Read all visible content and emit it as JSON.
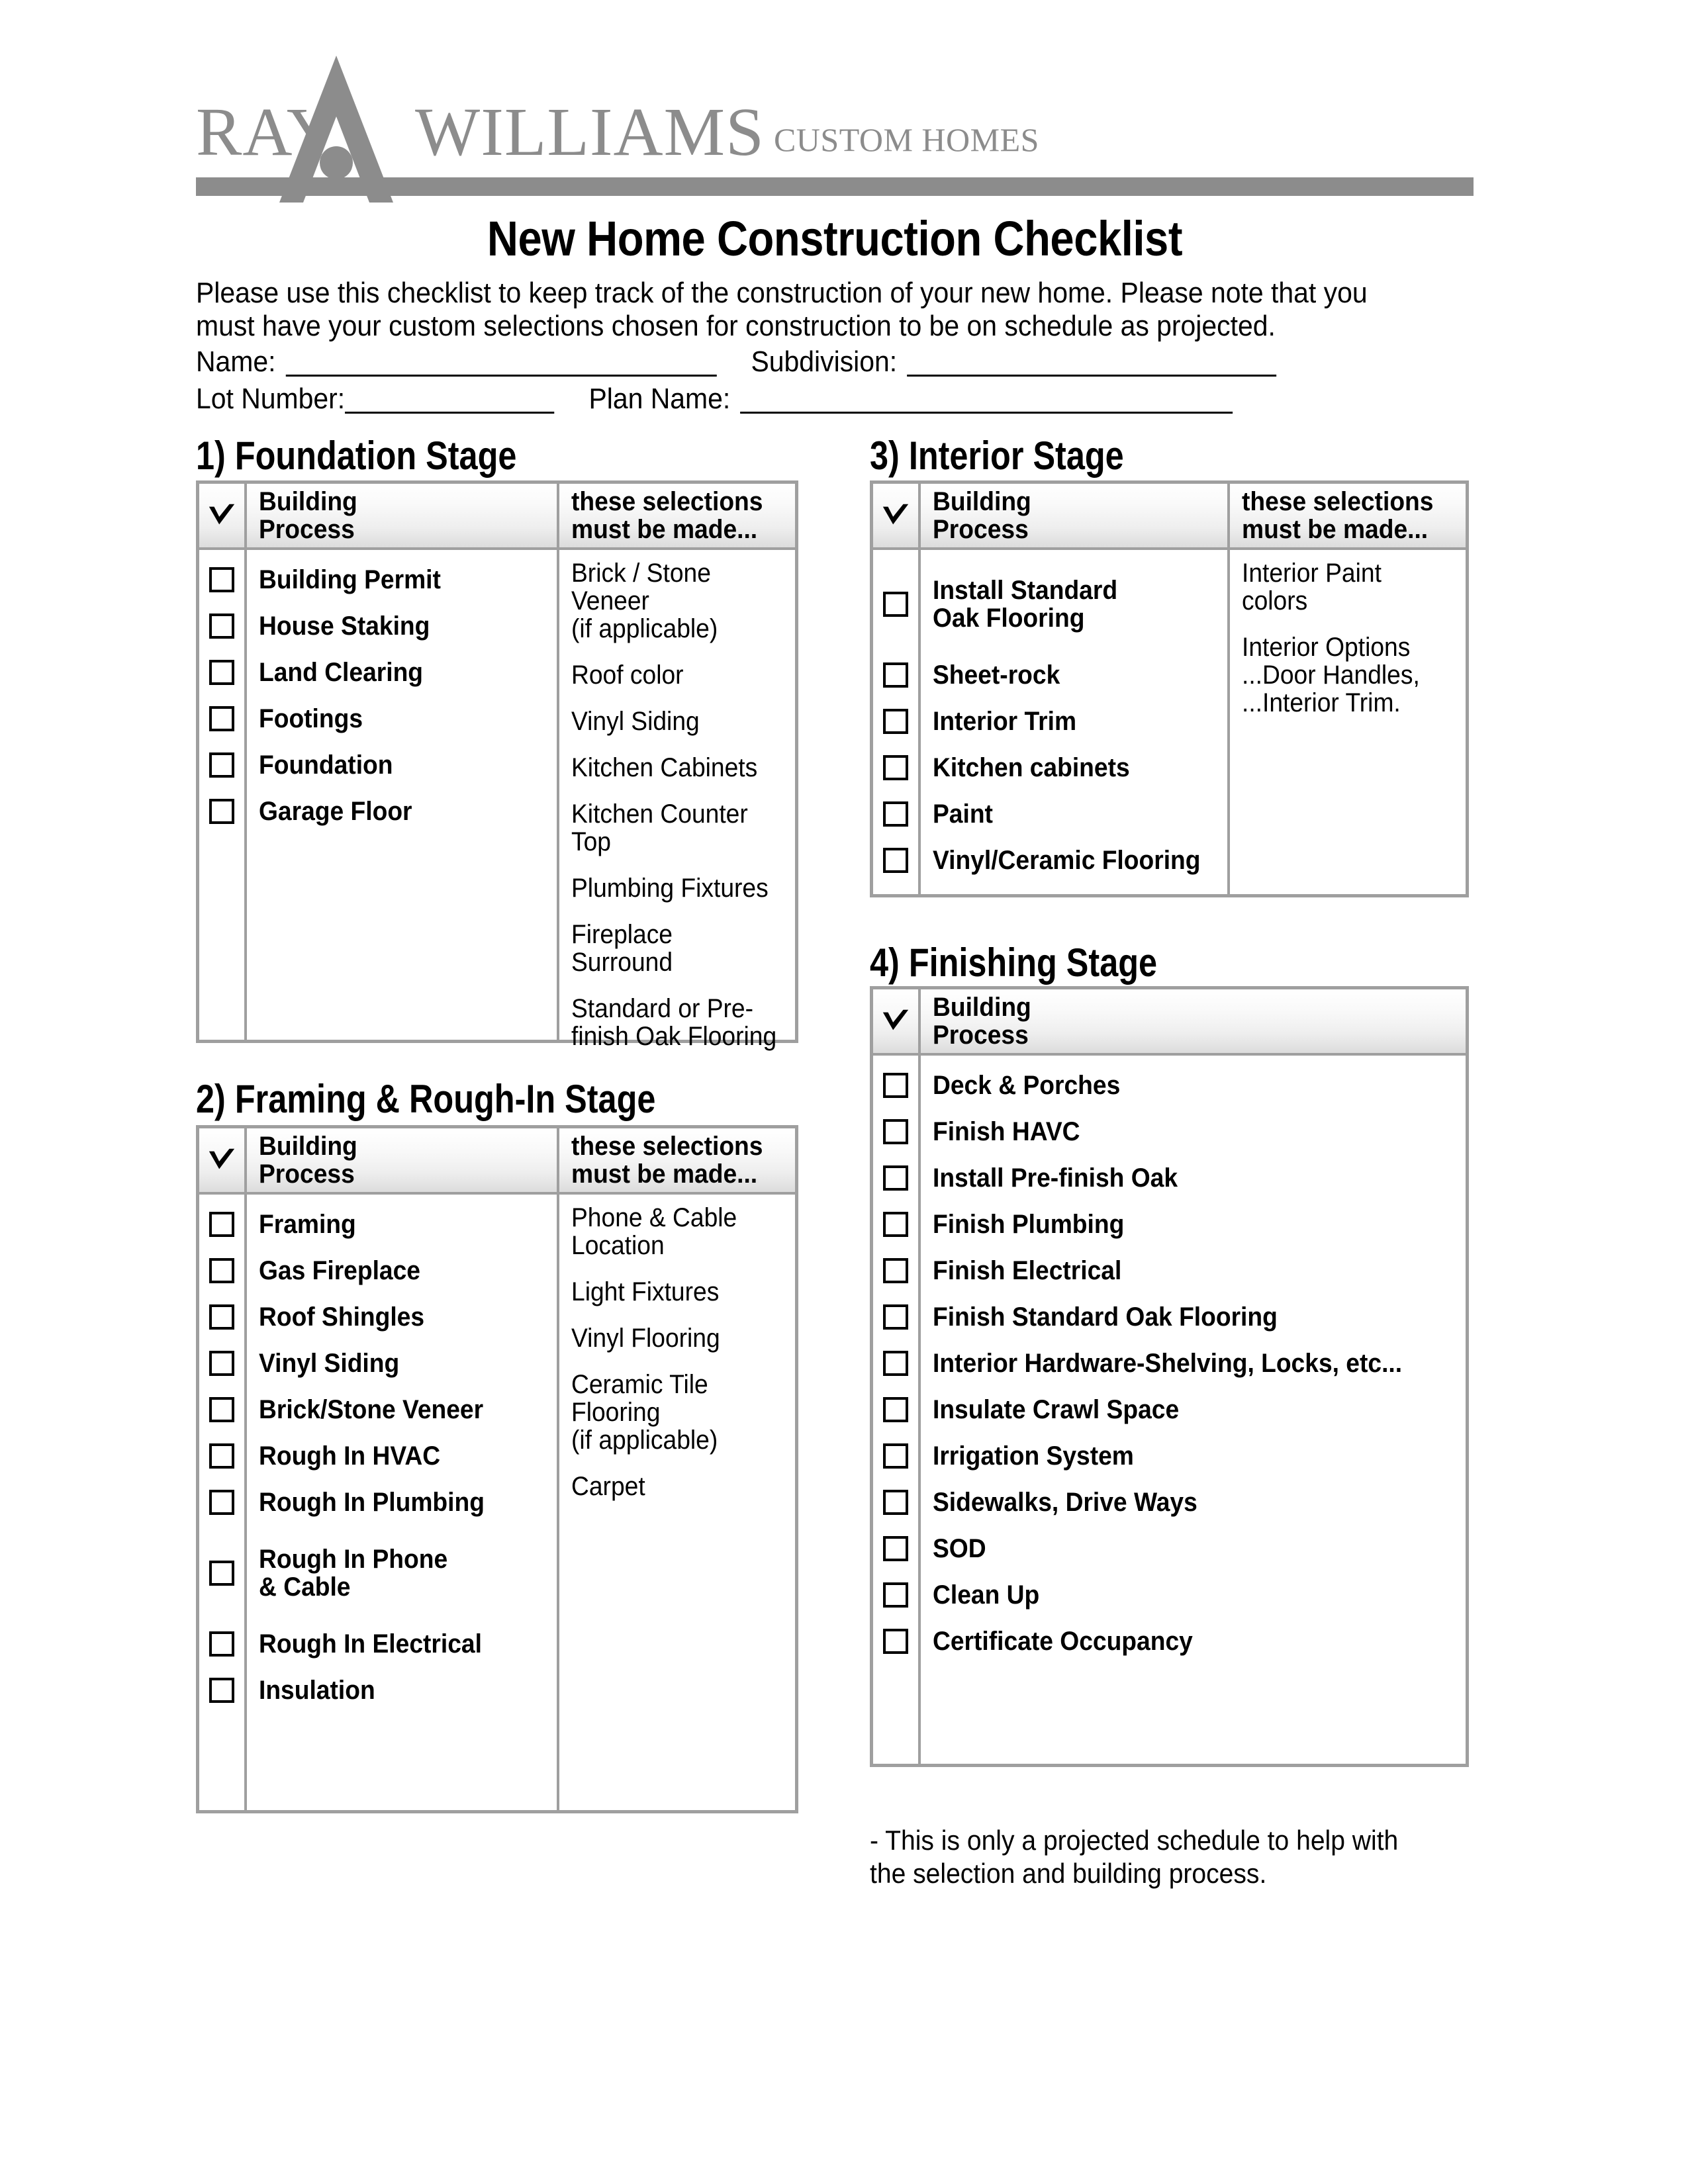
{
  "brand": {
    "name_part1": "RAY",
    "name_part2": "WILLIAMS",
    "tagline": "CUSTOM HOMES",
    "logo_color": "#8c8c8c",
    "mark_icon": "house-peak-icon"
  },
  "document": {
    "title": "New Home Construction Checklist",
    "intro": "Please use this checklist to keep track of the construction of your new home. Please note that you must have your custom selections chosen for construction to be on schedule as projected.",
    "footnote": "- This is only a projected schedule to help with the selection and building process."
  },
  "fields": {
    "name_label": "Name:",
    "subdivision_label": "Subdivision:",
    "lot_label": "Lot Number:",
    "plan_label": "Plan Name:",
    "name_value": "",
    "subdivision_value": "",
    "lot_value": "",
    "plan_value": ""
  },
  "table_headers": {
    "process": "Building\nProcess",
    "process_line1": "Building",
    "process_line2": "Process",
    "selections_line1": "these selections",
    "selections_line2": "must be made...",
    "check_icon": "checkmark-icon"
  },
  "sections": [
    {
      "number": "1)",
      "heading": "1) Foundation Stage",
      "process_items": [
        "Building Permit",
        "House Staking",
        "Land Clearing",
        "Footings",
        "Foundation",
        "Garage Floor"
      ],
      "selection_items": [
        "Brick / Stone Veneer\n(if applicable)",
        "Roof color",
        "Vinyl Siding",
        "Kitchen Cabinets",
        "Kitchen Counter Top",
        "Plumbing Fixtures",
        "Fireplace Surround",
        "Standard or Pre-\nfinish Oak Flooring"
      ]
    },
    {
      "number": "2)",
      "heading": "2) Framing & Rough-In Stage",
      "process_items": [
        "Framing",
        "Gas Fireplace",
        "Roof Shingles",
        "Vinyl Siding",
        "Brick/Stone Veneer",
        "Rough In HVAC",
        "Rough In Plumbing",
        "Rough In Phone\n& Cable",
        "Rough In Electrical",
        "Insulation"
      ],
      "selection_items": [
        "Phone & Cable\nLocation",
        "Light Fixtures",
        "Vinyl Flooring",
        "Ceramic Tile\nFlooring\n(if applicable)",
        "Carpet"
      ]
    },
    {
      "number": "3)",
      "heading": "3) Interior Stage",
      "process_items": [
        "Install Standard\nOak Flooring",
        "Sheet-rock",
        "Interior Trim",
        "Kitchen cabinets",
        "Paint",
        "Vinyl/Ceramic Flooring"
      ],
      "selection_items": [
        "Interior Paint colors",
        "Interior Options\n...Door Handles,\n...Interior Trim."
      ]
    },
    {
      "number": "4)",
      "heading": "4) Finishing Stage",
      "process_items": [
        "Deck & Porches",
        "Finish HAVC",
        "Install Pre-finish Oak",
        "Finish Plumbing",
        "Finish Electrical",
        "Finish Standard Oak Flooring",
        "Interior Hardware-Shelving, Locks, etc...",
        "Insulate Crawl Space",
        "Irrigation System",
        "Sidewalks, Drive Ways",
        "SOD",
        "Clean Up",
        "Certificate Occupancy"
      ],
      "selection_items": []
    }
  ],
  "colors": {
    "logo_gray": "#8c8c8c",
    "table_border": "#9f9f9f",
    "header_gradient_top": "#ffffff",
    "header_gradient_bottom": "#dcdcdc",
    "text": "#000000"
  }
}
